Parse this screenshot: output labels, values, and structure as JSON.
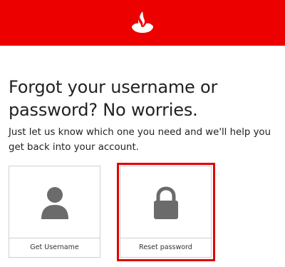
{
  "colors": {
    "brand_red": "#ec0000",
    "highlight_red": "#e00000",
    "icon_gray": "#6b6b6b"
  },
  "header": {
    "logo_icon": "flame-logo-icon"
  },
  "page": {
    "heading": "Forgot your username or password? No worries.",
    "subtext": "Just let us know which one you need and we'll help you get back into your account."
  },
  "options": [
    {
      "label": "Get Username",
      "icon": "user-icon"
    },
    {
      "label": "Reset password",
      "icon": "lock-icon"
    }
  ]
}
